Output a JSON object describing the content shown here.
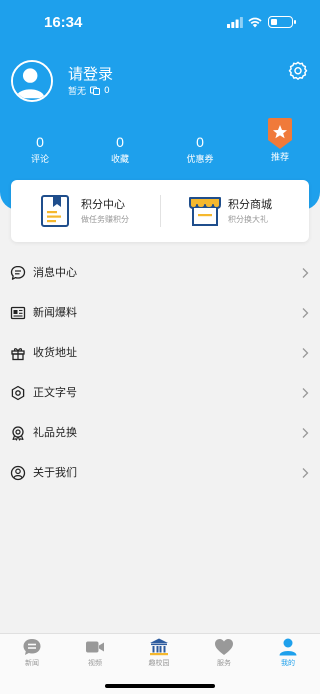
{
  "status_bar": {
    "time": "16:34"
  },
  "profile": {
    "login_text": "请登录",
    "sub_label": "暂无",
    "coin_count": "0"
  },
  "stats": [
    {
      "value": "0",
      "label": "评论"
    },
    {
      "value": "0",
      "label": "收藏"
    },
    {
      "value": "0",
      "label": "优惠券"
    }
  ],
  "recommend": {
    "label": "推荐"
  },
  "cards": [
    {
      "title": "积分中心",
      "subtitle": "做任务赚积分"
    },
    {
      "title": "积分商城",
      "subtitle": "积分换大礼"
    }
  ],
  "menu": [
    {
      "label": "消息中心",
      "icon": "message-icon"
    },
    {
      "label": "新闻爆料",
      "icon": "news-tip-icon"
    },
    {
      "label": "收货地址",
      "icon": "gift-box-icon"
    },
    {
      "label": "正文字号",
      "icon": "font-size-icon"
    },
    {
      "label": "礼品兑换",
      "icon": "gift-exchange-icon"
    },
    {
      "label": "关于我们",
      "icon": "about-icon"
    }
  ],
  "tabs": [
    {
      "label": "新闻",
      "icon": "news-icon"
    },
    {
      "label": "视频",
      "icon": "video-icon"
    },
    {
      "label": "趣校园",
      "icon": "campus-icon"
    },
    {
      "label": "服务",
      "icon": "heart-icon"
    },
    {
      "label": "我的",
      "icon": "user-icon"
    }
  ],
  "active_tab": "我的",
  "colors": {
    "primary": "#1ea0ec",
    "background": "#f2f2f2",
    "badge_orange": "#f07a3a"
  }
}
